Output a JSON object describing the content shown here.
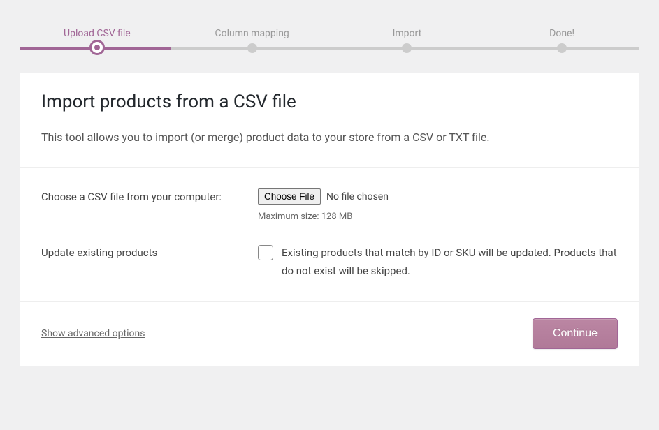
{
  "progress": {
    "steps": [
      {
        "label": "Upload CSV file",
        "active": true
      },
      {
        "label": "Column mapping",
        "active": false
      },
      {
        "label": "Import",
        "active": false
      },
      {
        "label": "Done!",
        "active": false
      }
    ]
  },
  "header": {
    "title": "Import products from a CSV file",
    "description": "This tool allows you to import (or merge) product data to your store from a CSV or TXT file."
  },
  "form": {
    "file": {
      "label": "Choose a CSV file from your computer:",
      "button": "Choose File",
      "status": "No file chosen",
      "hint": "Maximum size: 128 MB"
    },
    "update": {
      "label": "Update existing products",
      "description": "Existing products that match by ID or SKU will be updated. Products that do not exist will be skipped."
    }
  },
  "footer": {
    "advanced": "Show advanced options",
    "continue": "Continue"
  }
}
